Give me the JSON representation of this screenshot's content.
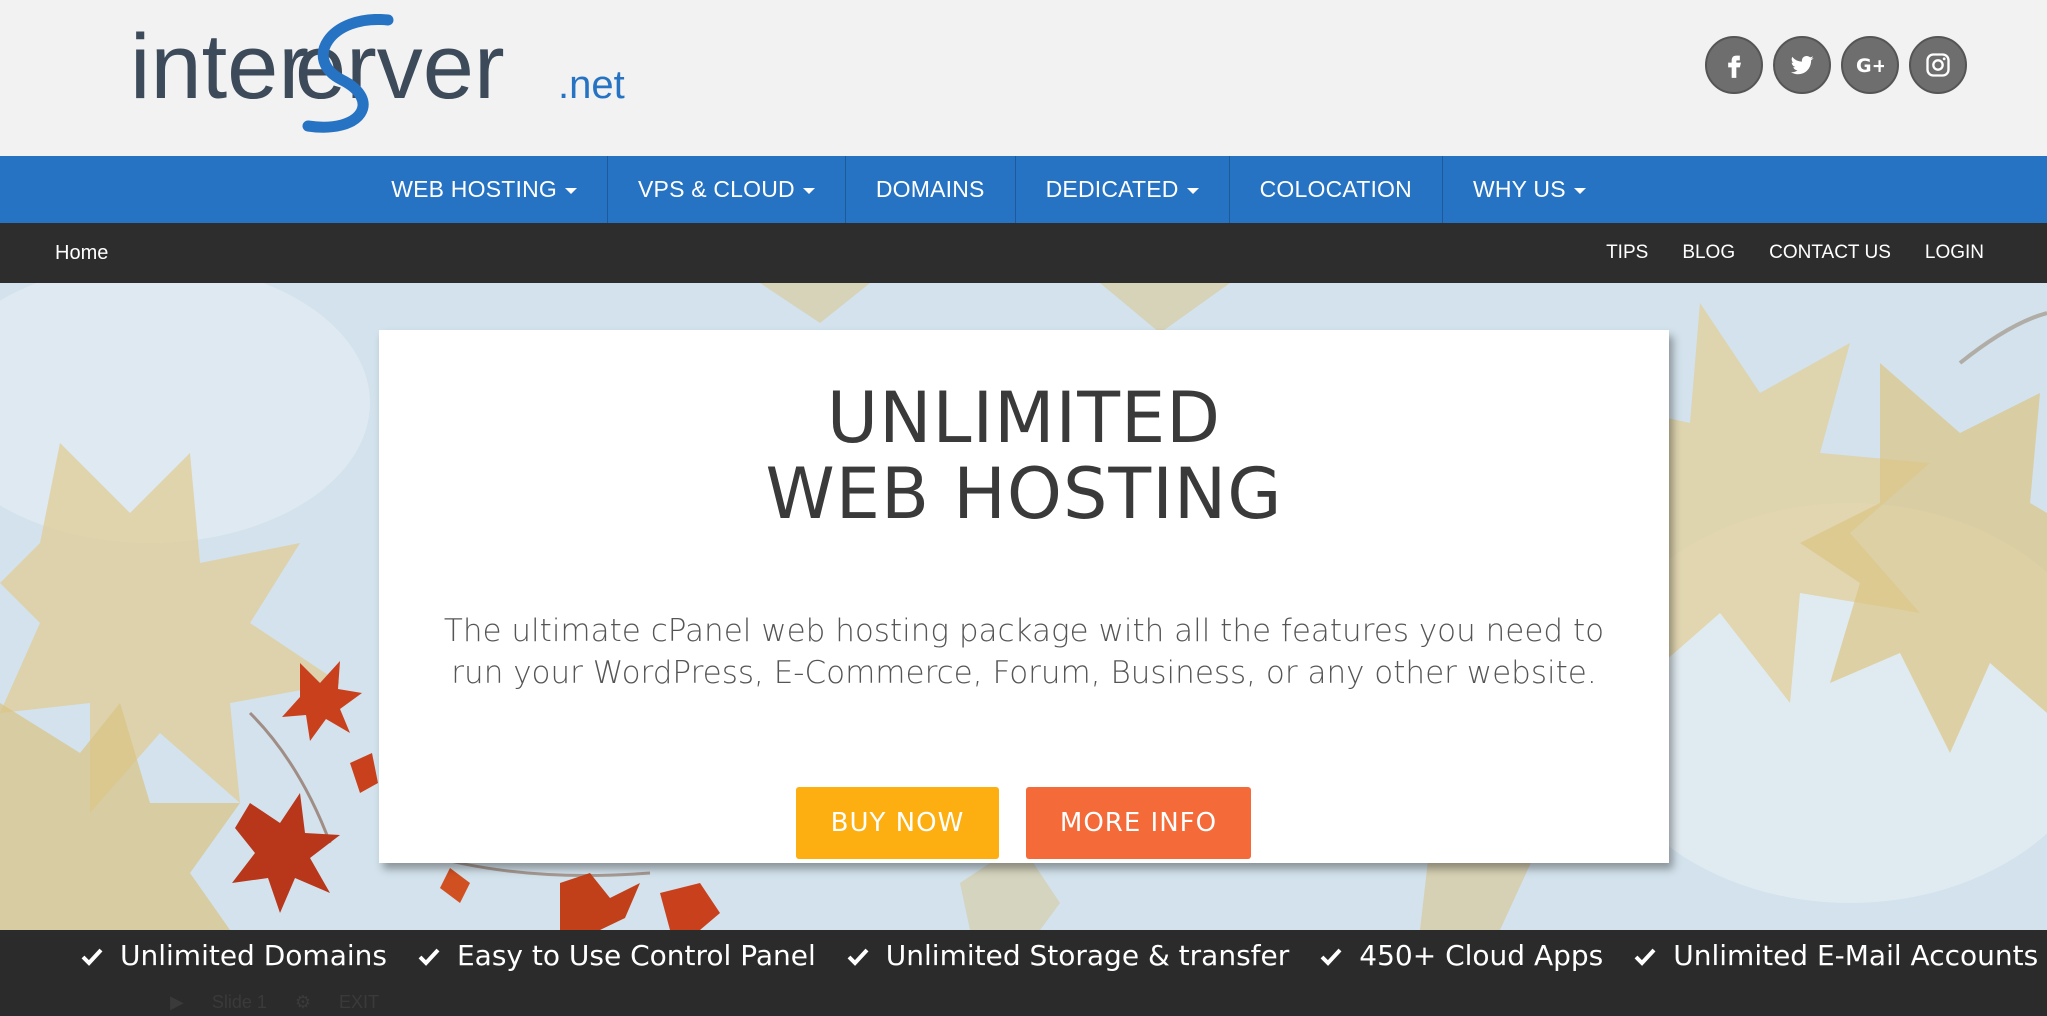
{
  "header": {
    "logo": {
      "part1": "inter",
      "part2": "Server",
      "part3": ".net"
    },
    "social": [
      {
        "name": "facebook",
        "glyph": "f"
      },
      {
        "name": "twitter",
        "glyph": "t"
      },
      {
        "name": "google-plus",
        "glyph": "G+"
      },
      {
        "name": "instagram",
        "glyph": "ig"
      }
    ]
  },
  "main_nav": {
    "items": [
      {
        "label": "WEB HOSTING",
        "dropdown": true
      },
      {
        "label": "VPS & CLOUD",
        "dropdown": true
      },
      {
        "label": "DOMAINS",
        "dropdown": false
      },
      {
        "label": "DEDICATED",
        "dropdown": true
      },
      {
        "label": "COLOCATION",
        "dropdown": false
      },
      {
        "label": "WHY US",
        "dropdown": true
      }
    ]
  },
  "sub_nav": {
    "home": "Home",
    "links": [
      "TIPS",
      "BLOG",
      "CONTACT US",
      "LOGIN"
    ]
  },
  "hero": {
    "title_line1": "UNLIMITED",
    "title_line2": "WEB HOSTING",
    "description": "The ultimate cPanel web hosting package with all the features you need to run your WordPress, E-Commerce, Forum, Business, or any other website.",
    "buy_button": "BUY NOW",
    "info_button": "MORE INFO"
  },
  "features": [
    "Unlimited Domains",
    "Easy to Use Control Panel",
    "Unlimited Storage & transfer",
    "450+ Cloud Apps",
    "Unlimited E-Mail Accounts"
  ],
  "slider": {
    "slide_label": "Slide 1",
    "exit_label": "EXIT"
  },
  "colors": {
    "nav_blue": "#2773c3",
    "sub_nav_dark": "#2d2d2d",
    "buy_orange": "#fdae10",
    "info_orange": "#f46a38",
    "logo_blue": "#2773c3",
    "logo_gray": "#3c4a5a"
  }
}
